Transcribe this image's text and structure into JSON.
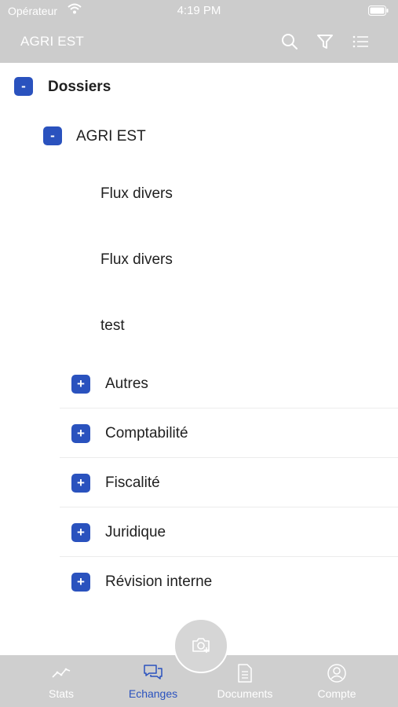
{
  "status_bar": {
    "carrier": "Opérateur",
    "time": "4:19 PM"
  },
  "nav": {
    "title": "AGRI EST",
    "icons": [
      "search-icon",
      "filter-icon",
      "list-icon"
    ]
  },
  "tree": {
    "root": {
      "toggle": "-",
      "label": "Dossiers"
    },
    "folder": {
      "toggle": "-",
      "label": "AGRI EST"
    },
    "items": [
      "Flux divers",
      "Flux divers",
      "test"
    ],
    "categories": [
      {
        "toggle": "+",
        "label": "Autres"
      },
      {
        "toggle": "+",
        "label": "Comptabilité"
      },
      {
        "toggle": "+",
        "label": "Fiscalité"
      },
      {
        "toggle": "+",
        "label": "Juridique"
      },
      {
        "toggle": "+",
        "label": "Révision interne"
      }
    ]
  },
  "fab": {
    "icon": "camera-add-icon"
  },
  "tabs": [
    {
      "label": "Stats",
      "icon": "stats-icon",
      "active": false
    },
    {
      "label": "Echanges",
      "icon": "chat-icon",
      "active": true
    },
    {
      "label": "Documents",
      "icon": "document-icon",
      "active": false
    },
    {
      "label": "Compte",
      "icon": "account-icon",
      "active": false
    }
  ],
  "colors": {
    "accent": "#2a52be",
    "bars": "#cccccc",
    "text": "#1f1f1f"
  }
}
